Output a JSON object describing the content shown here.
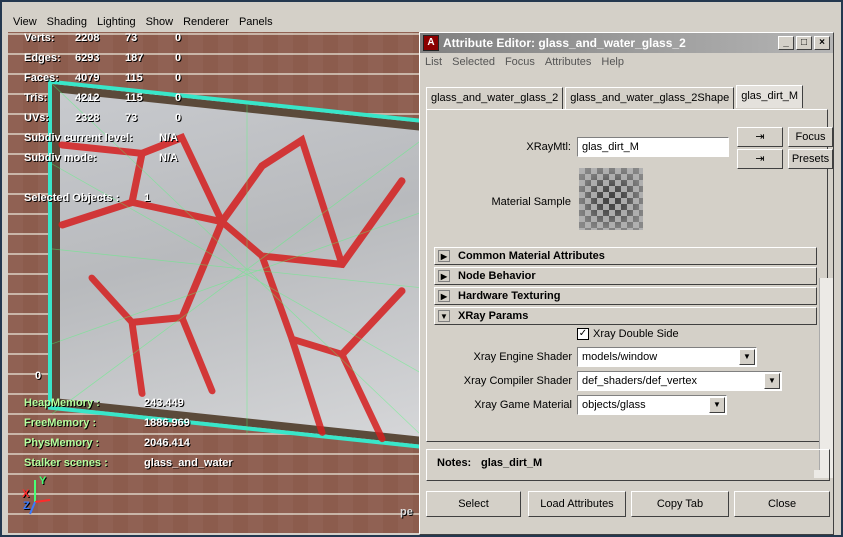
{
  "viewport_menu": [
    "View",
    "Shading",
    "Lighting",
    "Show",
    "Renderer",
    "Panels"
  ],
  "stats": [
    {
      "label": "Verts:",
      "a": "2208",
      "b": "73",
      "c": "0"
    },
    {
      "label": "Edges:",
      "a": "6293",
      "b": "187",
      "c": "0"
    },
    {
      "label": "Faces:",
      "a": "4079",
      "b": "115",
      "c": "0"
    },
    {
      "label": "Tris:",
      "a": "4212",
      "b": "115",
      "c": "0"
    },
    {
      "label": "UVs:",
      "a": "2328",
      "b": "73",
      "c": "0"
    }
  ],
  "subdiv_current_label": "Subdiv current level:",
  "subdiv_current_value": "N/A",
  "subdiv_mode_label": "Subdiv mode:",
  "subdiv_mode_value": "N/A",
  "selected_objects_label": "Selected Objects :",
  "selected_objects_value": "1",
  "left_zero": "0",
  "heap_memory_label": "HeapMemory :",
  "heap_memory_value": "243.449",
  "free_memory_label": "FreeMemory :",
  "free_memory_value": "1886.969",
  "phys_memory_label": "PhysMemory :",
  "phys_memory_value": "2046.414",
  "stalker_scenes_label": "Stalker scenes :",
  "stalker_scenes_value": "glass_and_water",
  "partial_text": "pe",
  "axis_x": "X",
  "axis_y": "Y",
  "axis_z": "Z",
  "editor": {
    "title": "Attribute Editor: glass_and_water_glass_2",
    "menu": [
      "List",
      "Selected",
      "Focus",
      "Attributes",
      "Help"
    ],
    "tabs": [
      "glass_and_water_glass_2",
      "glass_and_water_glass_2Shape",
      "glas_dirt_M"
    ],
    "xray_mtl_label": "XRayMtl:",
    "xray_mtl_value": "glas_dirt_M",
    "focus_button": "Focus",
    "presets_button": "Presets",
    "material_sample_label": "Material Sample",
    "sections": [
      "Common Material Attributes",
      "Node Behavior",
      "Hardware Texturing",
      "XRay Params"
    ],
    "xray_double_side_label": "Xray Double Side",
    "engine_shader_label": "Xray Engine Shader",
    "engine_shader_value": "models/window",
    "compiler_shader_label": "Xray Compiler Shader",
    "compiler_shader_value": "def_shaders/def_vertex",
    "game_material_label": "Xray Game Material",
    "game_material_value": "objects/glass",
    "notes_label": "Notes:",
    "notes_value": "glas_dirt_M",
    "buttons": [
      "Select",
      "Load Attributes",
      "Copy Tab",
      "Close"
    ]
  }
}
